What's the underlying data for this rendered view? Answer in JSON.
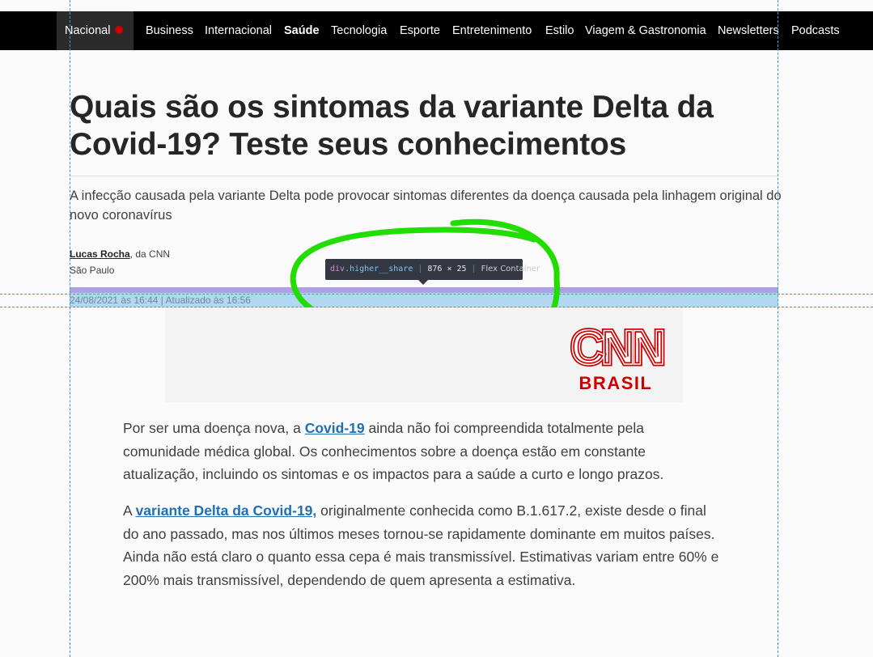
{
  "nav": {
    "items": [
      {
        "label": "Nacional"
      },
      {
        "label": "Business"
      },
      {
        "label": "Internacional"
      },
      {
        "label": "Saúde"
      },
      {
        "label": "Tecnologia"
      },
      {
        "label": "Esporte"
      },
      {
        "label": "Entretenimento"
      },
      {
        "label": "Estilo"
      },
      {
        "label": "Viagem & Gastronomia"
      },
      {
        "label": "Newsletters"
      },
      {
        "label": "Podcasts"
      }
    ]
  },
  "article": {
    "title_line1": "Quais são os sintomas da variante Delta da",
    "title_line2": "Covid-19? Teste seus conhecimentos",
    "subhead": "A infecção causada pela variante Delta pode provocar sintomas diferentes da doença causada pela linhagem original do novo coronavírus",
    "author": "Lucas Rocha",
    "author_suffix": ", da CNN",
    "location": "São Paulo",
    "dateline": "24/08/2021 às 16:44 | Atualizado às 16:56",
    "logo": {
      "line1": "CNN",
      "line2": "BRASIL",
      "color": "#cc0000"
    },
    "p1": {
      "before": "Por ser uma doença nova, a ",
      "link": "Covid-19",
      "after": " ainda não foi compreendida totalmente pela comunidade médica global. Os conhecimentos sobre a doença estão em constante atualização, incluindo os sintomas e os impactos para a saúde a curto e longo prazos."
    },
    "p2": {
      "before": "A ",
      "link": "variante Delta da Covid-19,",
      "after": " originalmente conhecida como B.1.617.2, existe desde o final do ano passado, mas nos últimos meses tornou-se rapidamente dominante em muitos países. Ainda não está claro o quanto essa cepa é mais transmissível. Estimativas variam entre 60% e 200% mais transmissível, dependendo de quem apresenta a estimativa."
    }
  },
  "devtools": {
    "tag": "div",
    "cls": ".higher__share",
    "size": "876 × 25",
    "type": "Flex Container"
  },
  "colors": {
    "nav_bg": "#000000",
    "link": "#1f6fb5",
    "annotation": "#22dd00",
    "highlight_purple": "#a99be4",
    "highlight_blue": "#a8d4ee"
  }
}
